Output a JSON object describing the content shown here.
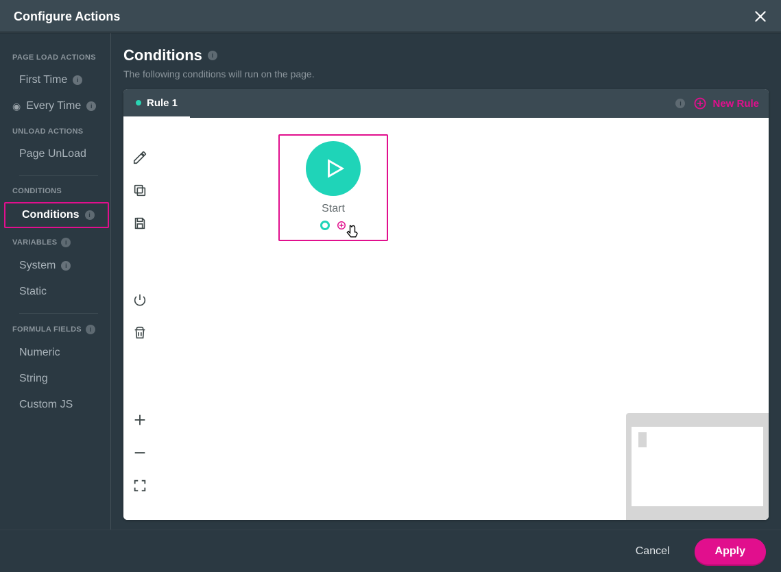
{
  "header": {
    "title": "Configure Actions"
  },
  "sidebar": {
    "page_load": {
      "heading": "PAGE LOAD ACTIONS",
      "first_time": "First Time",
      "every_time": "Every Time"
    },
    "unload": {
      "heading": "UNLOAD ACTIONS",
      "page_unload": "Page UnLoad"
    },
    "conditions_sec": {
      "heading": "CONDITIONS",
      "conditions": "Conditions"
    },
    "variables": {
      "heading": "VARIABLES",
      "system": "System",
      "static": "Static"
    },
    "formula": {
      "heading": "FORMULA FIELDS",
      "numeric": "Numeric",
      "string": "String",
      "custom_js": "Custom JS"
    }
  },
  "main": {
    "title": "Conditions",
    "subtitle": "The following conditions will run on the page.",
    "tab_label": "Rule 1",
    "new_rule": "New Rule",
    "start_label": "Start"
  },
  "footer": {
    "cancel": "Cancel",
    "apply": "Apply"
  }
}
